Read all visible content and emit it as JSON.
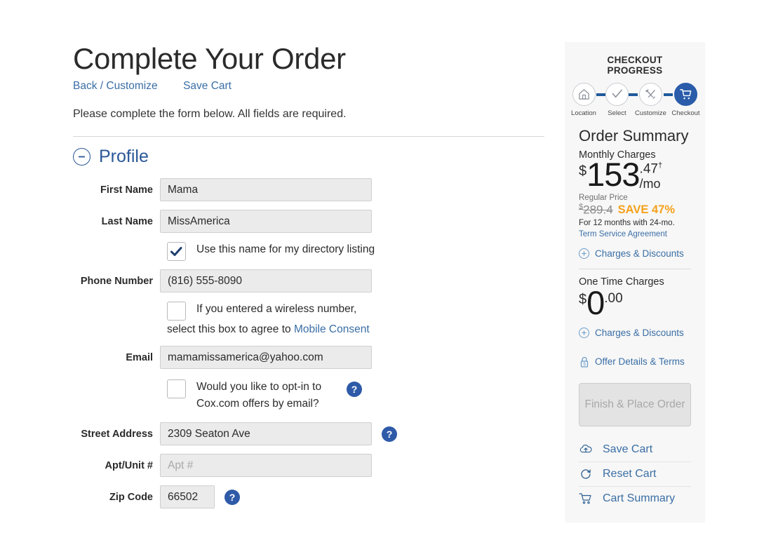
{
  "page": {
    "title": "Complete Your Order",
    "nav_links": [
      {
        "label": "Back / Customize",
        "name": "back-customize-link"
      },
      {
        "label": "Save Cart",
        "name": "save-cart-link"
      }
    ],
    "instructions": "Please complete the form below. All fields are required."
  },
  "profile_section": {
    "title": "Profile",
    "collapse_icon": "minus-circle-icon",
    "fields": {
      "first_name": {
        "label": "First Name",
        "value": "Mama",
        "placeholder": ""
      },
      "last_name": {
        "label": "Last Name",
        "value": "MissAmerica",
        "placeholder": ""
      },
      "phone_number": {
        "label": "Phone Number",
        "value": "(816) 555-8090",
        "placeholder": ""
      },
      "email": {
        "label": "Email",
        "value": "mamamissamerica@yahoo.com",
        "placeholder": ""
      },
      "street_address": {
        "label": "Street Address",
        "value": "2309 Seaton Ave",
        "placeholder": ""
      },
      "apt_unit": {
        "label": "Apt/Unit #",
        "value": "",
        "placeholder": "Apt #"
      },
      "zip_code": {
        "label": "Zip Code",
        "value": "66502",
        "placeholder": ""
      }
    },
    "checkboxes": {
      "directory_listing": {
        "label": "Use this name for my directory listing",
        "checked": true
      },
      "mobile_consent": {
        "line1": "If you entered a wireless number,",
        "line2_pre": "select this box to agree to ",
        "line2_link": "Mobile Consent",
        "checked": false
      },
      "email_optin": {
        "line1": "Would you like to opt-in to",
        "line2": "Cox.com offers by email?",
        "checked": false
      }
    },
    "help_icon_label": "?"
  },
  "sidebar": {
    "progress_title": "CHECKOUT PROGRESS",
    "steps": [
      {
        "label": "Location",
        "icon": "home-icon",
        "active": false
      },
      {
        "label": "Select",
        "icon": "check-icon",
        "active": false
      },
      {
        "label": "Customize",
        "icon": "tools-icon",
        "active": false
      },
      {
        "label": "Checkout",
        "icon": "cart-icon",
        "active": true
      }
    ],
    "order_summary_title": "Order Summary",
    "monthly": {
      "label": "Monthly Charges",
      "currency": "$",
      "whole": "153",
      "fraction": ".47",
      "dagger": "†",
      "per": "/mo",
      "regular_price_label": "Regular Price",
      "regular_currency": "$",
      "regular_price": "289.4",
      "save_text": "SAVE 47%",
      "terms_pre": "For 12 months with 24-mo. ",
      "terms_link": "Term Service Agreement",
      "charges_link": "Charges & Discounts"
    },
    "one_time": {
      "label": "One Time Charges",
      "currency": "$",
      "whole": "0",
      "fraction": ".00",
      "charges_link": "Charges & Discounts"
    },
    "offer_details_link": "Offer Details & Terms",
    "finish_button": "Finish & Place Order",
    "cart_links": [
      {
        "label": "Save Cart",
        "icon": "cloud-upload-icon"
      },
      {
        "label": "Reset Cart",
        "icon": "refresh-icon"
      },
      {
        "label": "Cart Summary",
        "icon": "shopping-cart-icon"
      }
    ]
  },
  "colors": {
    "accent_blue": "#2a5caa",
    "link_blue": "#3a6ea5",
    "save_orange": "#f5a11c",
    "field_gray": "#ebebeb",
    "sidebar_bg": "#f7f7f7"
  }
}
